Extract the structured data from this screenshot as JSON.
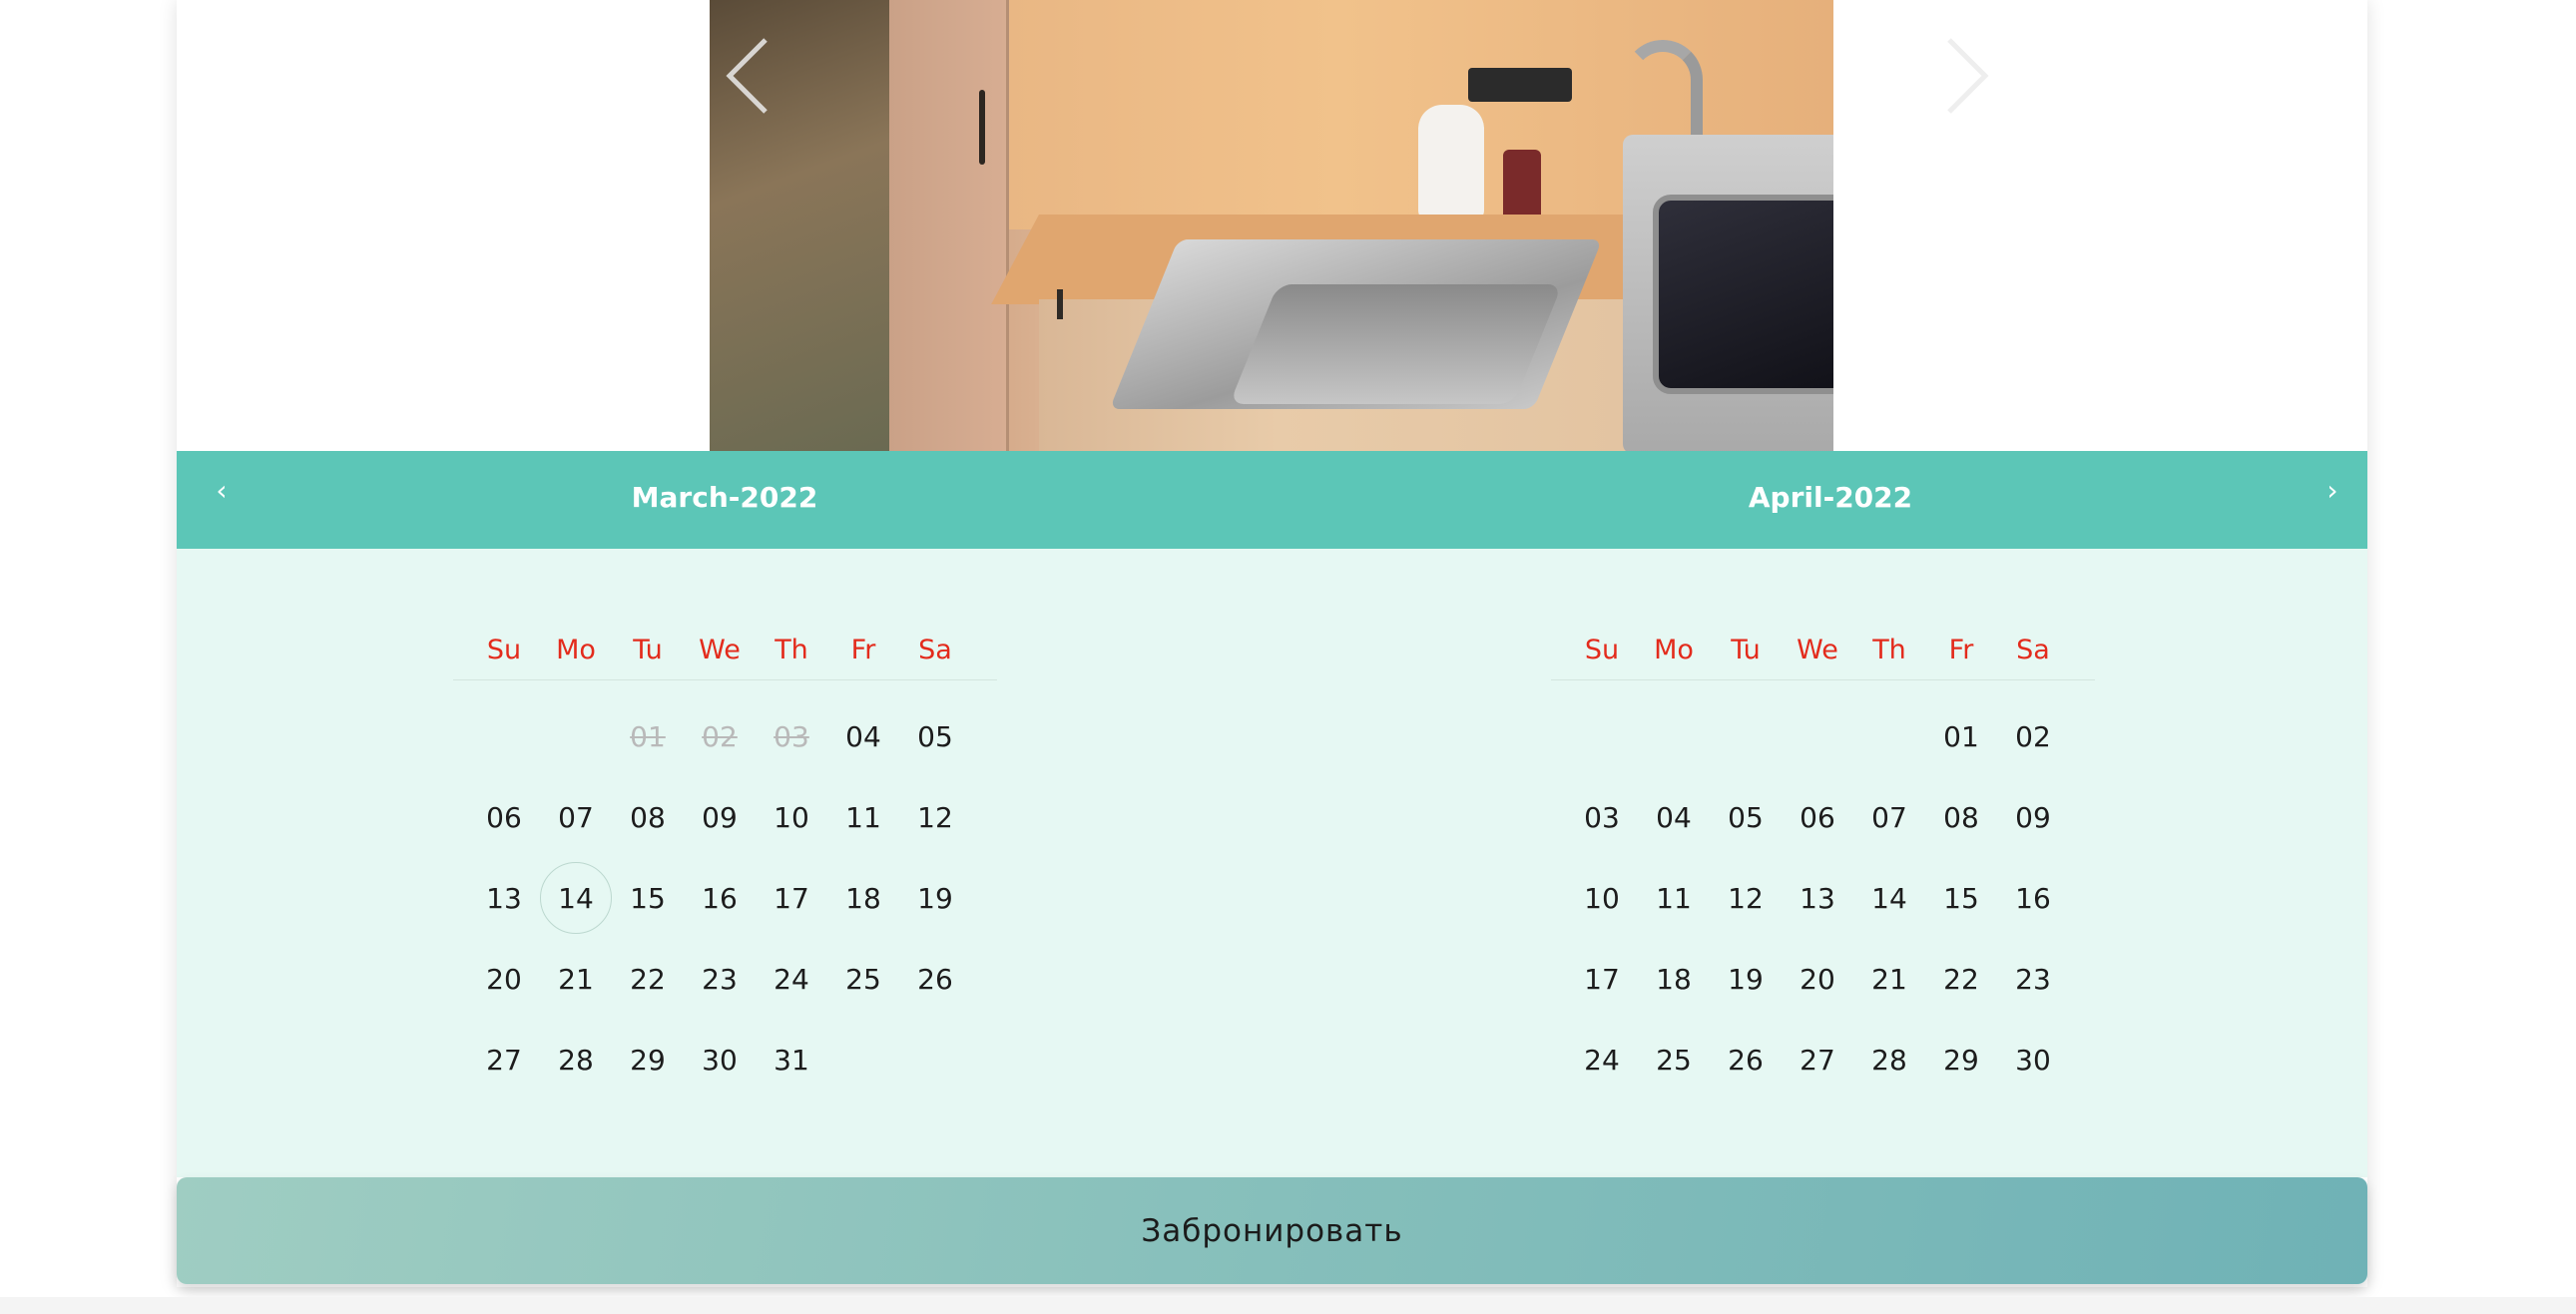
{
  "slider": {
    "image_alt": "Kitchen with sink and microwave",
    "prev_icon": "chevron-left-icon",
    "next_icon": "chevron-right-icon"
  },
  "calendar": {
    "prev_icon": "‹",
    "next_icon": "›",
    "weekdays": [
      "Su",
      "Mo",
      "Tu",
      "We",
      "Th",
      "Fr",
      "Sa"
    ],
    "months": [
      {
        "title": "March-2022",
        "weeks": [
          [
            "",
            "",
            "01",
            "02",
            "03",
            "04",
            "05"
          ],
          [
            "06",
            "07",
            "08",
            "09",
            "10",
            "11",
            "12"
          ],
          [
            "13",
            "14",
            "15",
            "16",
            "17",
            "18",
            "19"
          ],
          [
            "20",
            "21",
            "22",
            "23",
            "24",
            "25",
            "26"
          ],
          [
            "27",
            "28",
            "29",
            "30",
            "31",
            "",
            ""
          ]
        ],
        "disabled": [
          "01",
          "02",
          "03"
        ],
        "today": "14"
      },
      {
        "title": "April-2022",
        "weeks": [
          [
            "",
            "",
            "",
            "",
            "",
            "01",
            "02"
          ],
          [
            "03",
            "04",
            "05",
            "06",
            "07",
            "08",
            "09"
          ],
          [
            "10",
            "11",
            "12",
            "13",
            "14",
            "15",
            "16"
          ],
          [
            "17",
            "18",
            "19",
            "20",
            "21",
            "22",
            "23"
          ],
          [
            "24",
            "25",
            "26",
            "27",
            "28",
            "29",
            "30"
          ]
        ],
        "disabled": [],
        "today": ""
      }
    ]
  },
  "book_button": {
    "label": "Забронировать"
  },
  "colors": {
    "header_bg": "#5cc6b7",
    "body_bg": "#e6f8f3",
    "weekday_text": "#e32b1c",
    "disabled_text": "#b9b9b9"
  }
}
